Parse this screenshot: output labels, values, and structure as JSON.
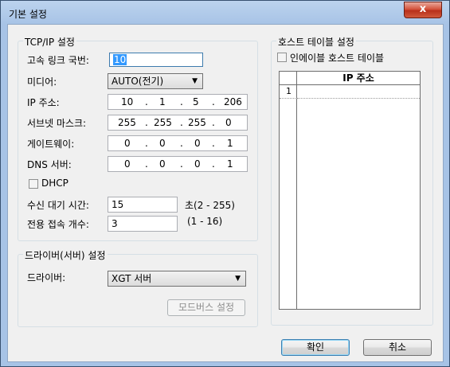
{
  "window": {
    "title": "기본 설정",
    "close_glyph": "x"
  },
  "tcpip": {
    "title": "TCP/IP 설정",
    "link_station_label": "고속 링크 국번:",
    "link_station_value": "10",
    "media_label": "미디어:",
    "media_value": "AUTO(전기)",
    "ip_label": "IP 주소:",
    "ip": [
      "10",
      "1",
      "5",
      "206"
    ],
    "subnet_label": "서브넷 마스크:",
    "subnet": [
      "255",
      "255",
      "255",
      "0"
    ],
    "gateway_label": "게이트웨이:",
    "gateway": [
      "0",
      "0",
      "0",
      "1"
    ],
    "dns_label": "DNS 서버:",
    "dns": [
      "0",
      "0",
      "0",
      "1"
    ],
    "dhcp_label": "DHCP",
    "receive_wait_label": "수신 대기 시간:",
    "receive_wait_value": "15",
    "receive_wait_range": "초(2 - 255)",
    "dedicated_count_label": "전용 접속 개수:",
    "dedicated_count_value": "3",
    "dedicated_count_range": "(1 - 16)",
    "dot": "."
  },
  "driver": {
    "title": "드라이버(서버) 설정",
    "driver_label": "드라이버:",
    "driver_value": "XGT 서버",
    "modbus_button": "모드버스 설정"
  },
  "host_table": {
    "title": "호스트 테이블 설정",
    "enable_label": "인에이블 호스트 테이블",
    "column_header": "IP 주소",
    "rows": [
      "1"
    ]
  },
  "buttons": {
    "ok": "확인",
    "cancel": "취소"
  }
}
